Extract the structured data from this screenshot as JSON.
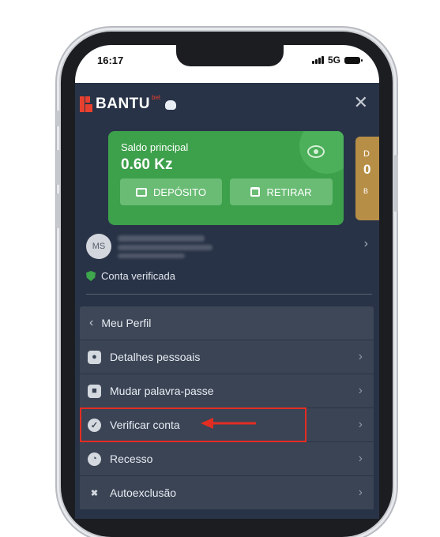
{
  "status_bar": {
    "time": "16:17",
    "network": "5G"
  },
  "header": {
    "logo_text": "BANTU",
    "logo_suffix": "bet",
    "close_icon": "close-icon"
  },
  "balance_card": {
    "label": "Saldo principal",
    "value": "0.60 Kz",
    "deposit_label": "DEPÓSITO",
    "withdraw_label": "RETIRAR",
    "color": "#3da04b"
  },
  "bonus_card": {
    "letter_top": "D",
    "letter_mid": "0",
    "letter_bot": "B"
  },
  "user": {
    "initials": "MS",
    "verified_text": "Conta verificada"
  },
  "menu": {
    "back_label": "Meu Perfil",
    "items": [
      {
        "label": "Detalhes pessoais",
        "icon": "user-icon"
      },
      {
        "label": "Mudar palavra-passe",
        "icon": "lock-icon"
      },
      {
        "label": "Verificar conta",
        "icon": "verify-icon"
      },
      {
        "label": "Recesso",
        "icon": "timer-icon"
      },
      {
        "label": "Autoexclusão",
        "icon": "user-block-icon"
      }
    ]
  },
  "annotation": {
    "highlight_color": "#e42d22"
  }
}
